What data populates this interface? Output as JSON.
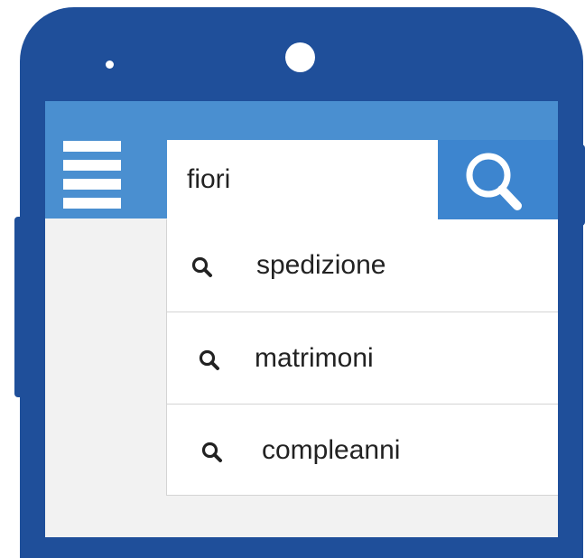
{
  "colors": {
    "phone_body": "#1f4f9a",
    "app_bar": "#4a8fd0",
    "search_button": "#3d85cf",
    "screen_background": "#f2f2f2"
  },
  "search": {
    "value": "fiori",
    "button_icon": "search-icon"
  },
  "menu": {
    "icon": "hamburger-menu-icon"
  },
  "suggestions": [
    {
      "label": "spedizione",
      "icon": "search-icon"
    },
    {
      "label": "matrimoni",
      "icon": "search-icon"
    },
    {
      "label": "compleanni",
      "icon": "search-icon"
    }
  ]
}
